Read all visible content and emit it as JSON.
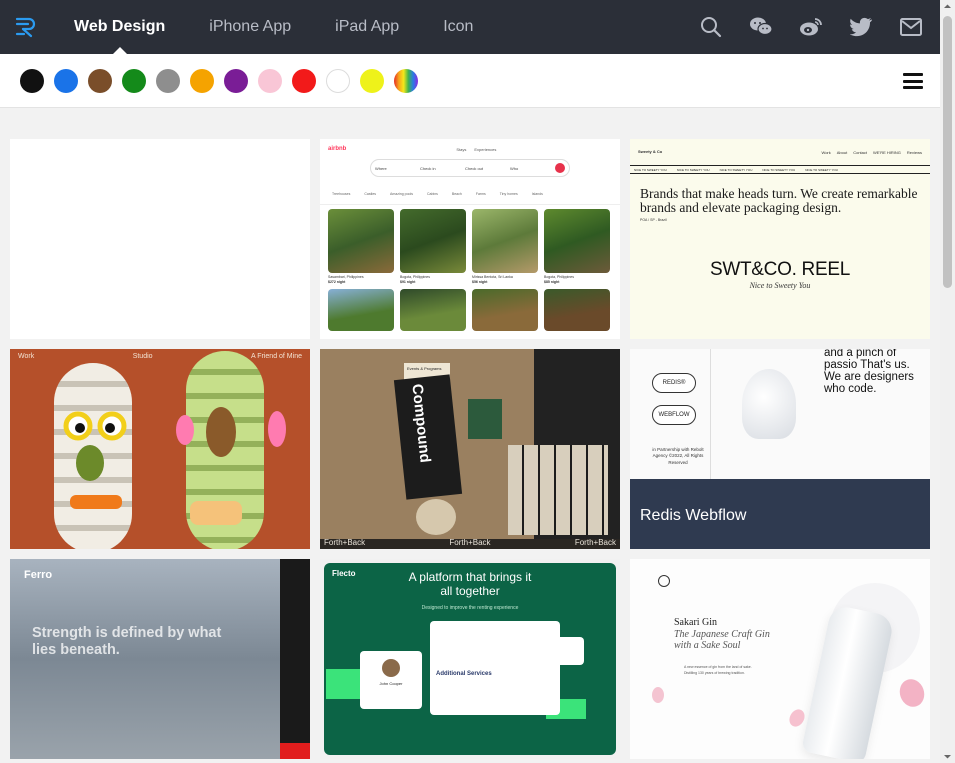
{
  "nav": {
    "logo_icon": "r-logo-icon",
    "links": [
      {
        "label": "Web Design",
        "active": true
      },
      {
        "label": "iPhone App",
        "active": false
      },
      {
        "label": "iPad App",
        "active": false
      },
      {
        "label": "Icon",
        "active": false
      }
    ],
    "icons": [
      "search-icon",
      "wechat-icon",
      "weibo-icon",
      "twitter-icon",
      "mail-icon"
    ]
  },
  "colors": {
    "swatches": [
      "#111111",
      "#1a73e8",
      "#7a4e2a",
      "#148a1a",
      "#8e8e8e",
      "#f5a300",
      "#7a1d96",
      "#f9c6d6",
      "#f21a1a",
      "#ffffff",
      "#eef21a",
      "rainbow"
    ],
    "menu_icon": "hamburger-icon"
  },
  "cards": {
    "airbnb": {
      "logo": "airbnb",
      "tabs": [
        "Stays",
        "Experiences"
      ],
      "search": [
        "Where",
        "Check in",
        "Check out",
        "Who"
      ],
      "categories": [
        "Treehouses",
        "Castles",
        "Amazing pools",
        "Cabins",
        "Beach",
        "Farms",
        "Tiny homes",
        "Islands"
      ],
      "listings": [
        {
          "place": "Sasambari, Philippines",
          "rating": "4.94",
          "price": "$272 night"
        },
        {
          "place": "Bogota, Philippines",
          "rating": "4.90",
          "price": "$91 night"
        },
        {
          "place": "Mirissa Bentota, Sri Lanka",
          "rating": "4.96",
          "price": "$56 night"
        },
        {
          "place": "Bogota, Philippines",
          "rating": "4.90",
          "price": "$85 night"
        }
      ]
    },
    "sweety": {
      "brand": "Sweety & Co",
      "menu": [
        "Work",
        "About",
        "Contact",
        "WE'RE HIRING",
        "Reviews"
      ],
      "marquee": "NICE TO SWEETY YOU",
      "headline": "Brands that make heads turn. We create remarkable brands and elevate packaging design.",
      "location": "POA / SP - Brazil",
      "reel": "SWT&CO. REEL",
      "signature": "Nice to Sweety You"
    },
    "sculpture": {
      "left": "Work",
      "middle": "Studio",
      "right": "A Friend of Mine"
    },
    "compound": {
      "poster_word": "Compound",
      "brand": "Forth+Back",
      "label": "Events & Programs"
    },
    "redis": {
      "title": "Redis Webflow",
      "tagline": "and a pinch of passio That's us. We are designers who code.",
      "badge1": "REDIS®",
      "badge2": "WEBFLOW",
      "partnership": "in Partnership with Rebolt Agency ©2022, All Rights Reserved"
    },
    "ferro": {
      "logo": "Ferro",
      "headline": "Strength is defined by what lies beneath."
    },
    "flecto": {
      "logo": "Flecto",
      "headline": "A platform that brings it all together",
      "sub": "Designed to improve the renting experience",
      "section": "Additional Services",
      "person": "John Cooper"
    },
    "sakari": {
      "title": "Sakari Gin",
      "subtitle": "The Japanese Craft Gin with a Sake Soul",
      "body": "A new essence of gin from the land of sake. Distilling 130 years of brewing tradition."
    }
  },
  "scrollbar": {
    "position": 0.0
  }
}
